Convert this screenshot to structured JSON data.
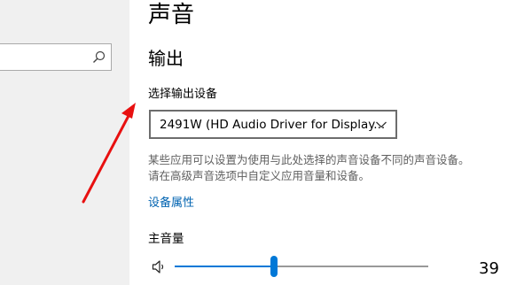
{
  "page_title": "声音",
  "output": {
    "section_title": "输出",
    "select_device_label": "选择输出设备",
    "selected_device": "2491W (HD Audio Driver for Display...",
    "description_lines": [
      "某些应用可以设置为使用与此处选择的声音设备不同的声音设备。",
      "请在高级声音选项中自定义应用音量和设备。"
    ],
    "device_properties_link": "设备属性",
    "master_volume_label": "主音量",
    "volume": 39
  },
  "icons": {
    "search": "search-icon",
    "dropdown": "chevron-down-icon",
    "speaker": "speaker-icon"
  },
  "colors": {
    "accent": "#0078d7",
    "link": "#0063b1",
    "annotation_arrow": "#e81010"
  }
}
